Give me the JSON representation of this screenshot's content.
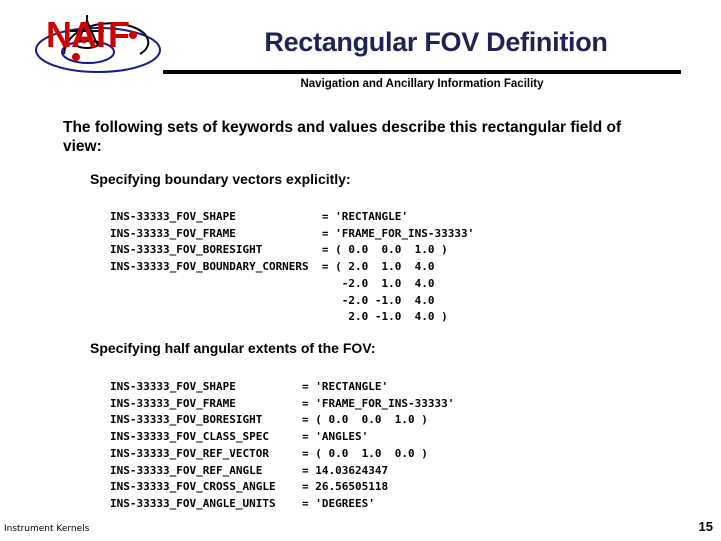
{
  "header": {
    "title": "Rectangular FOV Definition",
    "subtitle": "Navigation and Ancillary Information Facility",
    "logo_text": "NAIF",
    "logo_alt": "naif-logo",
    "title_color": "#1f2352",
    "rule_color": "#000000",
    "logo_text_color": "#cc0000",
    "logo_orbit_color": "#1a1a8c"
  },
  "body": {
    "intro": "The following sets of keywords and values describe this rectangular field of view:",
    "section1": {
      "heading": "Specifying boundary vectors explicitly:",
      "code": "INS-33333_FOV_SHAPE             = 'RECTANGLE'\nINS-33333_FOV_FRAME             = 'FRAME_FOR_INS-33333'\nINS-33333_FOV_BORESIGHT         = ( 0.0  0.0  1.0 )\nINS-33333_FOV_BOUNDARY_CORNERS  = ( 2.0  1.0  4.0\n                                   -2.0  1.0  4.0\n                                   -2.0 -1.0  4.0\n                                    2.0 -1.0  4.0 )"
    },
    "section2": {
      "heading": "Specifying half angular extents of the FOV:",
      "code": "INS-33333_FOV_SHAPE          = 'RECTANGLE'\nINS-33333_FOV_FRAME          = 'FRAME_FOR_INS-33333'\nINS-33333_FOV_BORESIGHT      = ( 0.0  0.0  1.0 )\nINS-33333_FOV_CLASS_SPEC     = 'ANGLES'\nINS-33333_FOV_REF_VECTOR     = ( 0.0  1.0  0.0 )\nINS-33333_FOV_REF_ANGLE      = 14.03624347\nINS-33333_FOV_CROSS_ANGLE    = 26.56505118\nINS-33333_FOV_ANGLE_UNITS    = 'DEGREES'"
    }
  },
  "footer": {
    "label": "Instrument Kernels",
    "page_number": "15"
  }
}
